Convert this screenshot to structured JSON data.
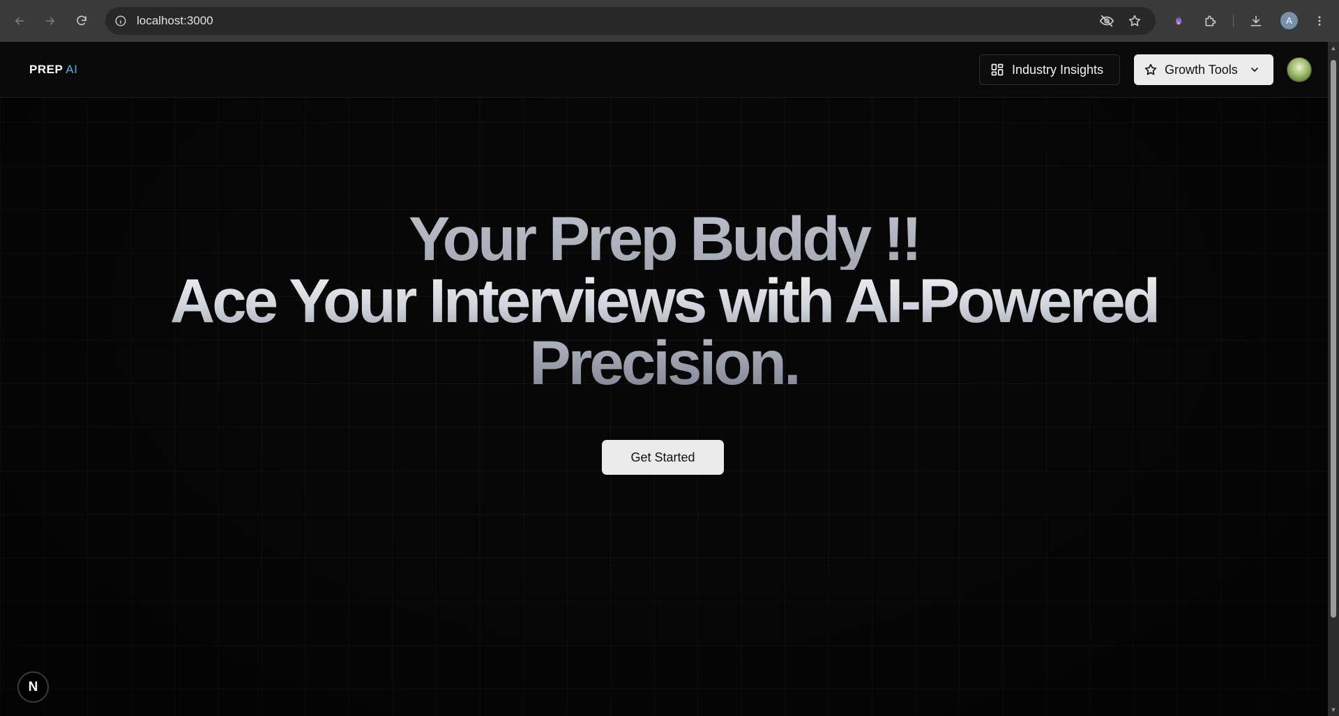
{
  "browser": {
    "url": "localhost:3000",
    "profile_initial": "A",
    "icons": {
      "back": "arrow-left-icon",
      "forward": "arrow-right-icon",
      "reload": "reload-icon",
      "site_info": "info-icon",
      "eye_off": "eye-off-icon",
      "bookmark": "star-icon",
      "extension_flame": "flame-icon",
      "extensions": "puzzle-icon",
      "downloads": "download-icon",
      "menu": "more-vertical-icon"
    }
  },
  "header": {
    "logo_main": "PREP",
    "logo_accent": "AI",
    "insights_label": "Industry Insights",
    "growth_label": "Growth Tools"
  },
  "hero": {
    "line1": "Your Prep Buddy !!",
    "line2": "Ace Your Interviews with AI-Powered",
    "line3": "Precision.",
    "cta_label": "Get Started"
  },
  "dev": {
    "badge_label": "N"
  },
  "colors": {
    "background": "#070707",
    "accent": "#49b6e8",
    "button_light": "#ececec"
  }
}
